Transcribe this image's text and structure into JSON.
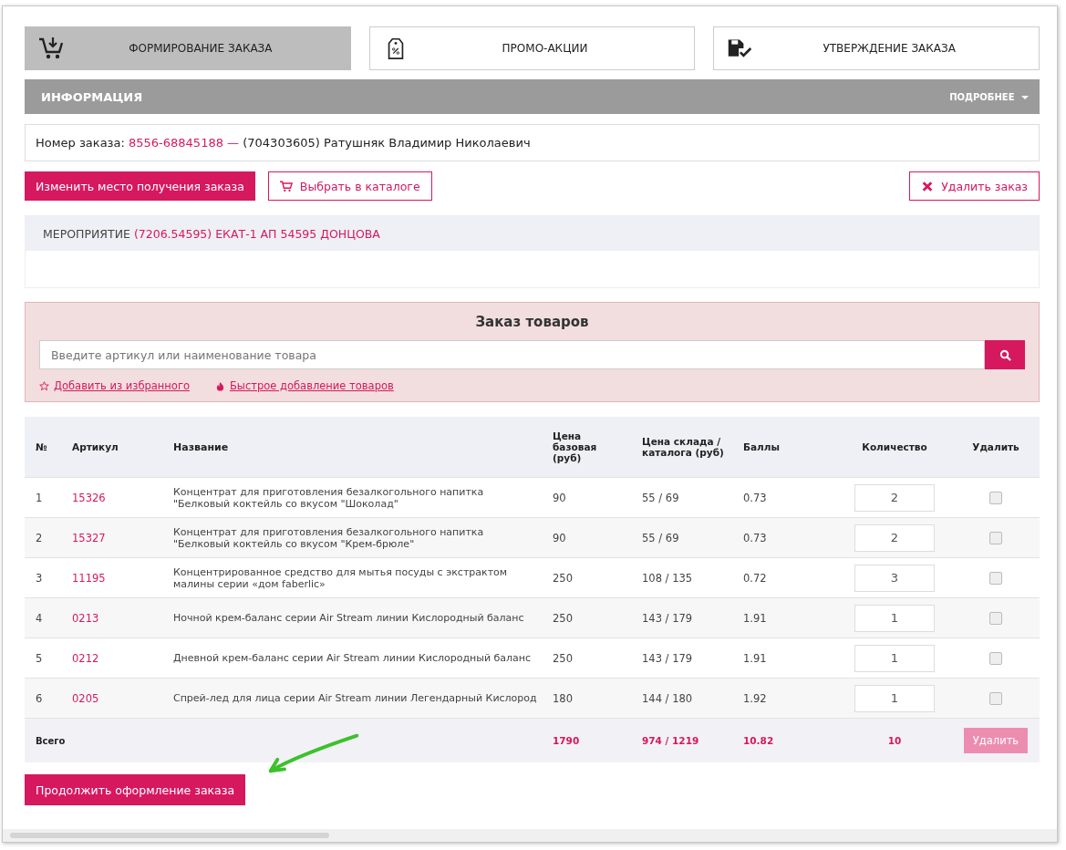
{
  "tabs": [
    {
      "label": "ФОРМИРОВАНИЕ ЗАКАЗА",
      "kind": "cart",
      "selected": true
    },
    {
      "label": "ПРОМО-АКЦИИ",
      "kind": "tag",
      "selected": false
    },
    {
      "label": "УТВЕРЖДЕНИЕ ЗАКАЗА",
      "kind": "approve",
      "selected": false
    }
  ],
  "info_bar": {
    "title": "ИНФОРМАЦИЯ",
    "more": "ПОДРОБНЕЕ"
  },
  "order_line": {
    "label": "Номер заказа:",
    "number": "8556-68845188 —",
    "customer": "(704303605) Ратушняк Владимир Николаевич"
  },
  "actions": {
    "change_pickup": "Изменить место получения заказа",
    "catalog": "Выбрать в каталоге",
    "delete_order": "Удалить заказ"
  },
  "event": {
    "label": "МЕРОПРИЯТИЕ",
    "value": "(7206.54595) ЕКАТ-1 АП 54595 ДОНЦОВА"
  },
  "goods_order": {
    "title": "Заказ товаров",
    "placeholder": "Введите артикул или наименование товара",
    "links": [
      {
        "kind": "star",
        "label": "Добавить из избранного"
      },
      {
        "kind": "fire",
        "label": "Быстрое добавление товаров"
      }
    ]
  },
  "table": {
    "columns": [
      "№",
      "Артикул",
      "Название",
      "Цена базовая (руб)",
      "Цена склада / каталога (руб)",
      "Баллы",
      "Количество",
      "Удалить"
    ],
    "rows": [
      {
        "n": "1",
        "sku": "15326",
        "name": "Концентрат для приготовления безалкогольного напитка \"Белковый коктейль со вкусом \"Шоколад\"",
        "base": "90",
        "price": "55 / 69",
        "points": "0.73",
        "qty": "2",
        "checked": false
      },
      {
        "n": "2",
        "sku": "15327",
        "name": "Концентрат для приготовления безалкогольного напитка \"Белковый коктейль со вкусом \"Крем-брюле\"",
        "base": "90",
        "price": "55 / 69",
        "points": "0.73",
        "qty": "2",
        "checked": false
      },
      {
        "n": "3",
        "sku": "11195",
        "name": "Концентрированное средство для мытья посуды с экстрактом малины серии «дом faberlic»",
        "base": "250",
        "price": "108 / 135",
        "points": "0.72",
        "qty": "3",
        "checked": false
      },
      {
        "n": "4",
        "sku": "0213",
        "name": "Ночной крем-баланс серии Air Stream линии Кислородный баланс",
        "base": "250",
        "price": "143 / 179",
        "points": "1.91",
        "qty": "1",
        "checked": false
      },
      {
        "n": "5",
        "sku": "0212",
        "name": "Дневной крем-баланс серии Air Stream линии Кислородный баланс",
        "base": "250",
        "price": "143 / 179",
        "points": "1.91",
        "qty": "1",
        "checked": false
      },
      {
        "n": "6",
        "sku": "0205",
        "name": "Спрей-лед для лица серии Air Stream линии Легендарный Кислород",
        "base": "180",
        "price": "144 / 180",
        "points": "1.92",
        "qty": "1",
        "checked": false
      }
    ],
    "total": {
      "label": "Всего",
      "base": "1790",
      "price": "974 / 1219",
      "points": "10.82",
      "qty": "10",
      "delete": "Удалить",
      "delete_disabled": true
    }
  },
  "continue": "Продолжить оформление заказа"
}
